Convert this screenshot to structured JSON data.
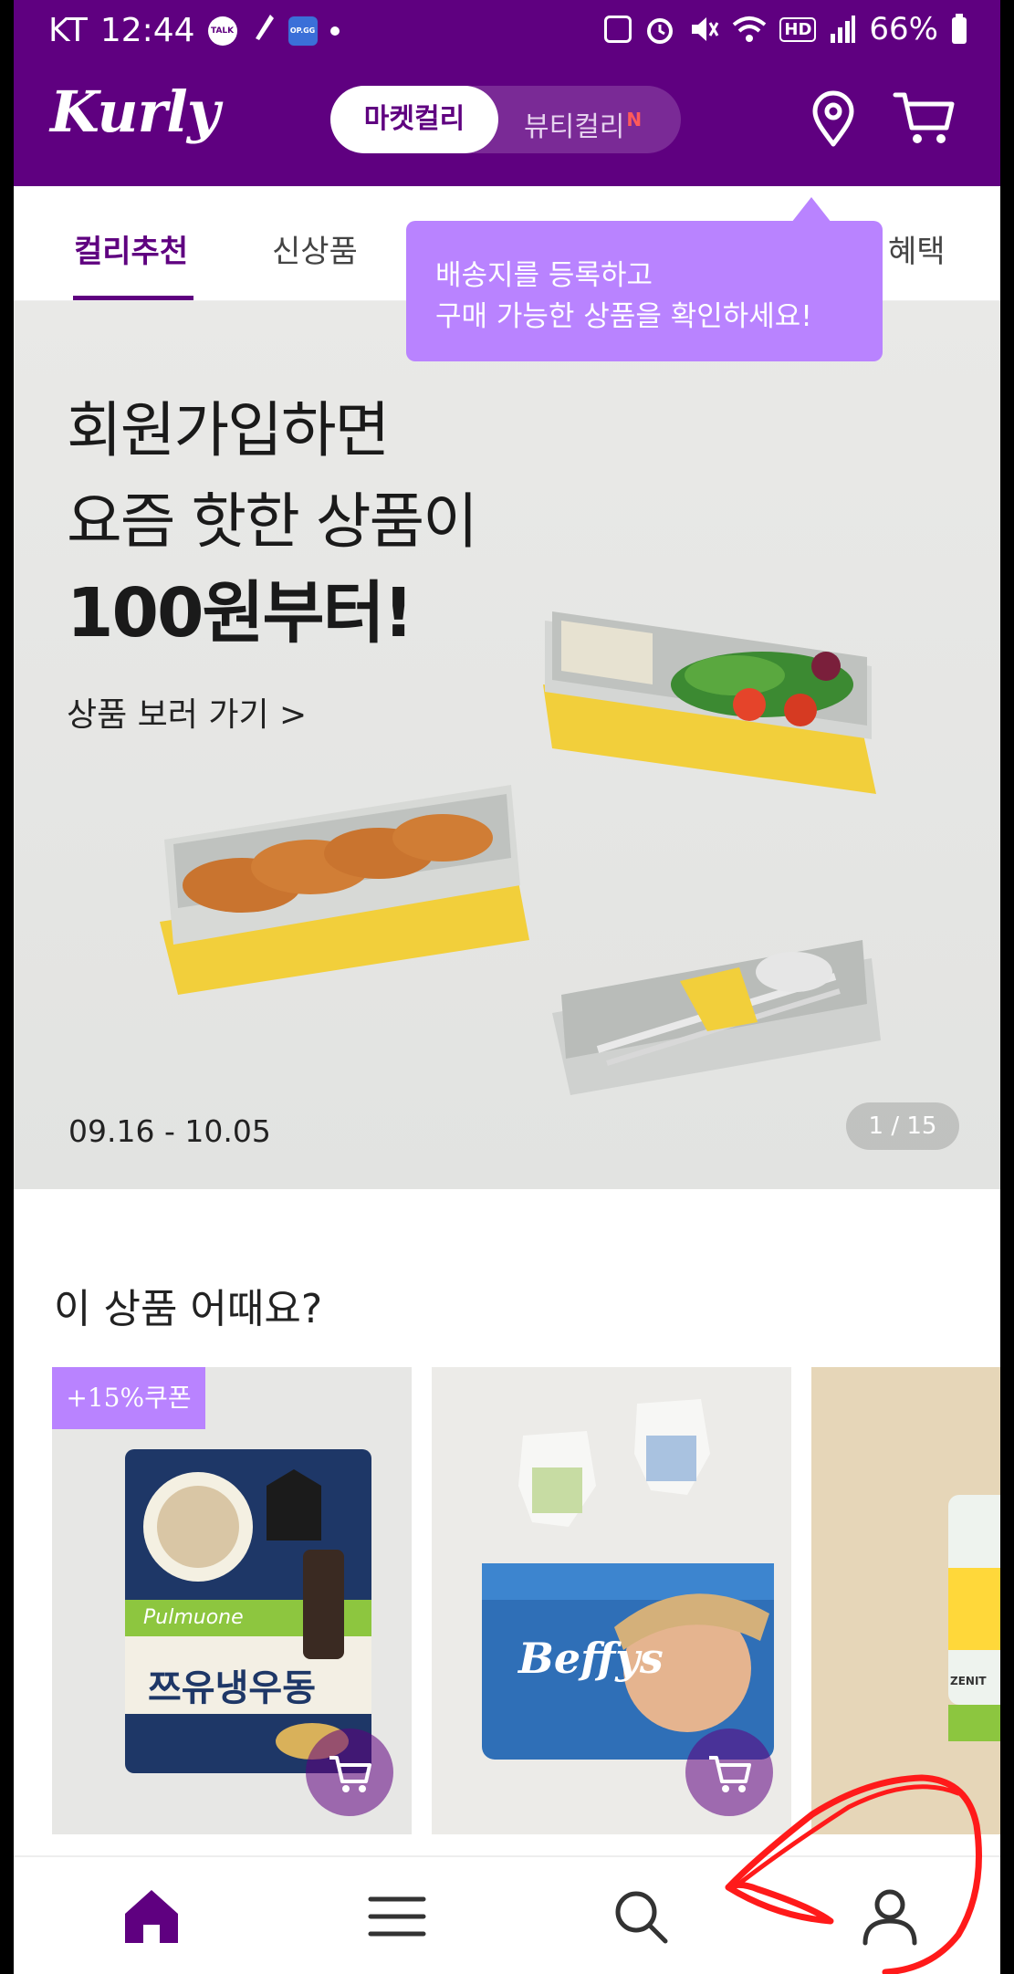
{
  "status_bar": {
    "carrier": "KT",
    "time": "12:44",
    "battery": "66%",
    "left_icons": [
      "talk-icon",
      "pen-icon",
      "opgg-icon"
    ],
    "right_icons": [
      "recycle-icon",
      "alarm-icon",
      "mute-icon",
      "wifi-icon",
      "hd-icon",
      "signal-icon",
      "battery-icon"
    ],
    "talk_badge": "TALK",
    "opgg_badge": "OP.GG"
  },
  "header": {
    "logo": "Kurly",
    "switch": {
      "active": "마켓컬리",
      "inactive": "뷰티컬리",
      "badge": "N"
    },
    "icons": [
      "location-pin-icon",
      "cart-icon"
    ]
  },
  "tabs": {
    "items": [
      {
        "label": "컬리추천",
        "active": true
      },
      {
        "label": "신상품",
        "active": false
      },
      {
        "label": "혜택",
        "active": false
      }
    ]
  },
  "tooltip": {
    "line1": "배송지를 등록하고",
    "line2": "구매 가능한 상품을 확인하세요!"
  },
  "banner": {
    "line1": "회원가입하면",
    "line2": "요즘 핫한 상품이",
    "line3": "100원부터!",
    "cta": "상품 보러 가기 >",
    "date": "09.16 - 10.05",
    "page": "1 / 15"
  },
  "recommend": {
    "title": "이 상품 어때요?",
    "products": [
      {
        "coupon": "+15%쿠폰",
        "brand_text": "Pulmuone",
        "product_text": "쯔유냉우동"
      },
      {
        "coupon": "",
        "brand_text": "Beffys",
        "product_text": ""
      },
      {
        "coupon": "",
        "brand_text": "ZENIT",
        "product_text": ""
      }
    ]
  },
  "bottom_nav": {
    "items": [
      "home-icon",
      "menu-icon",
      "search-icon",
      "my-page-icon"
    ]
  },
  "colors": {
    "brand_purple": "#5f0080",
    "tooltip_purple": "#b983ff",
    "annotation_red": "#ff1a1a"
  }
}
